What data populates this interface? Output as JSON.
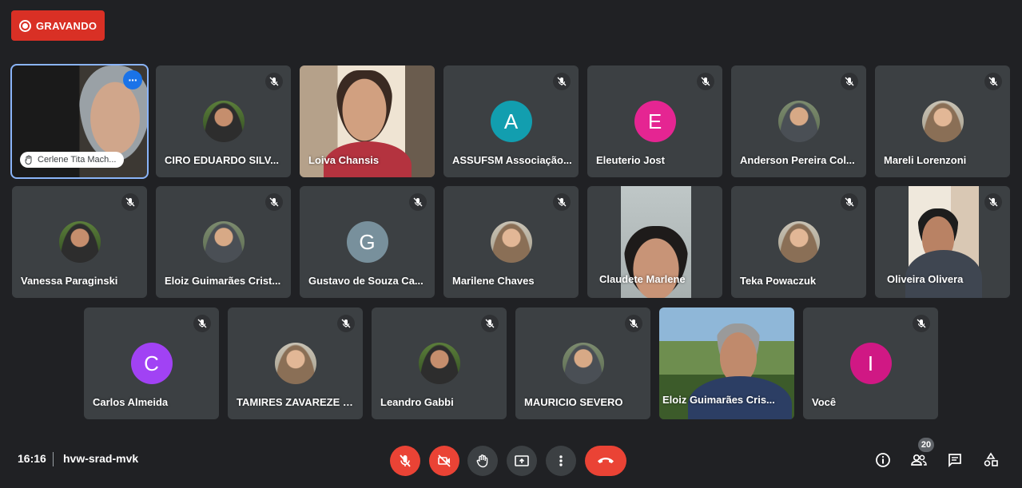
{
  "recording": {
    "label": "GRAVANDO",
    "color": "#d93025"
  },
  "participants": {
    "cerlene": {
      "chip": "Cerlene Tita Mach..."
    },
    "ciro": {
      "name": "CIRO EDUARDO SILV..."
    },
    "loiva": {
      "name": "Loiva Chansis"
    },
    "assufsm": {
      "name": "ASSUFSM Associação...",
      "initial": "A",
      "color": "#129eaf"
    },
    "eleuterio": {
      "name": "Eleuterio Jost",
      "initial": "E",
      "color": "#e52592"
    },
    "anderson": {
      "name": "Anderson Pereira Col..."
    },
    "mareli": {
      "name": "Mareli Lorenzoni"
    },
    "vanessa": {
      "name": "Vanessa Paraginski"
    },
    "eloiz1": {
      "name": "Eloiz Guimarães Crist..."
    },
    "gustavo": {
      "name": "Gustavo de Souza Ca...",
      "initial": "G",
      "color": "#78909c"
    },
    "marilene": {
      "name": "Marilene Chaves"
    },
    "claudete": {
      "name": "Claudete Marlene"
    },
    "teka": {
      "name": "Teka Powaczuk"
    },
    "oliveira": {
      "name": "Oliveira Olivera"
    },
    "carlos": {
      "name": "Carlos Almeida",
      "initial": "C",
      "color": "#a142f4"
    },
    "tamires": {
      "name": "TAMIRES ZAVAREZE D..."
    },
    "leandro": {
      "name": "Leandro Gabbi"
    },
    "mauricio": {
      "name": "MAURICIO SEVERO"
    },
    "eloiz2": {
      "name": "Eloiz Guimarães Cris..."
    },
    "voce": {
      "name": "Você",
      "initial": "I",
      "color": "#d01884"
    }
  },
  "bottom_bar": {
    "time": "16:16",
    "meeting_code": "hvw-srad-mvk",
    "participant_count": "20"
  },
  "icons": {
    "mic_muted": "mic-off-icon",
    "cam_off": "videocam-off-icon",
    "hand": "raise-hand-icon",
    "present": "present-screen-icon",
    "more": "more-vert-icon",
    "leave": "call-end-icon",
    "info": "info-icon",
    "people": "people-icon",
    "chat": "chat-icon",
    "activities": "activities-icon"
  }
}
